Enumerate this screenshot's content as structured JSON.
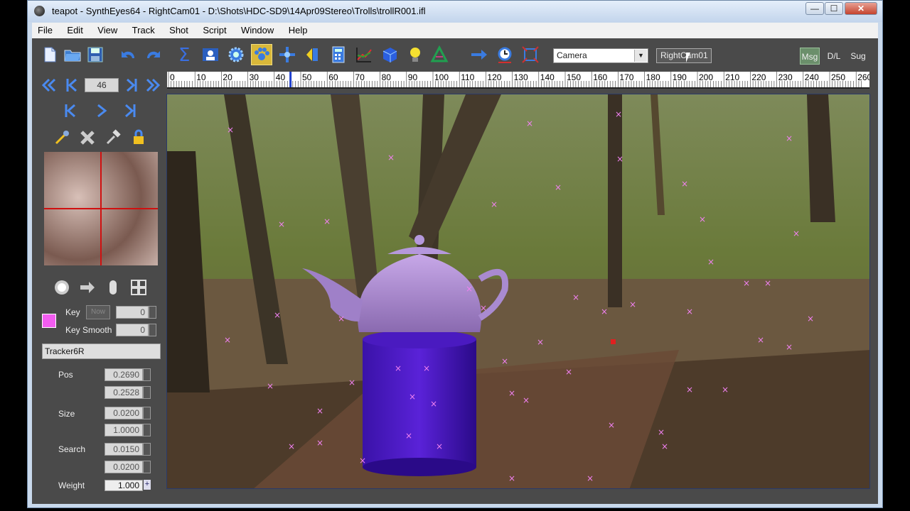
{
  "window": {
    "title": "teapot - SynthEyes64 - RightCam01 - D:\\Shots\\HDC-SD9\\14Apr09Stereo\\Trolls\\trollR001.ifl",
    "min": "—",
    "max": "☐",
    "close": "✕"
  },
  "menu": [
    "File",
    "Edit",
    "View",
    "Track",
    "Shot",
    "Script",
    "Window",
    "Help"
  ],
  "toolbar": {
    "mode_dropdown": "Camera",
    "camera_field": "RightCam01",
    "toggles": [
      "Msg",
      "D/L",
      "Sug"
    ]
  },
  "timeline": {
    "frame": "46",
    "ticks": [
      "0",
      "10",
      "20",
      "30",
      "40",
      "50",
      "60",
      "70",
      "80",
      "90",
      "100",
      "110",
      "120",
      "130",
      "140",
      "150",
      "160",
      "170",
      "180",
      "190",
      "200",
      "210",
      "220",
      "230",
      "240",
      "250",
      "260"
    ]
  },
  "tracker": {
    "key_label": "Key",
    "key_button": "Now",
    "key_value": "0",
    "key_smooth_label": "Key Smooth",
    "key_smooth_value": "0",
    "name": "Tracker6R",
    "color": "#f25cf0",
    "pos_label": "Pos",
    "pos_x": "0.2690",
    "pos_y": "0.2528",
    "size_label": "Size",
    "size_x": "0.0200",
    "size_y": "1.0000",
    "search_label": "Search",
    "search_x": "0.0150",
    "search_y": "0.0200",
    "weight_label": "Weight",
    "weight_value": "1.000"
  }
}
